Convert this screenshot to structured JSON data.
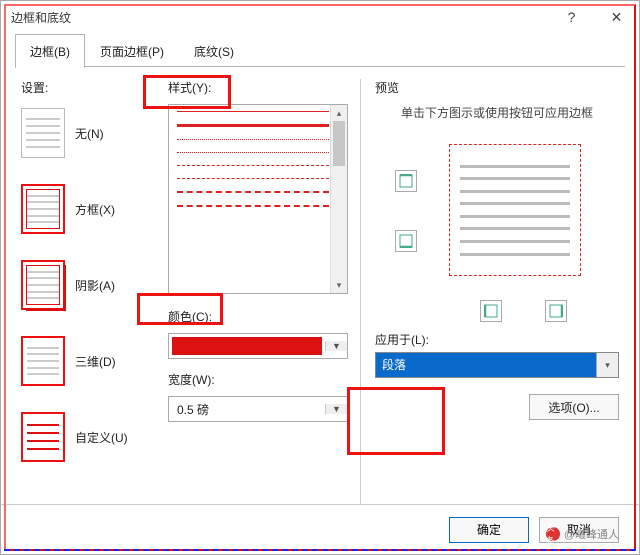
{
  "window": {
    "title": "边框和底纹",
    "help": "?",
    "close": "✕"
  },
  "tabs": {
    "borders": "边框(B)",
    "page_borders": "页面边框(P)",
    "shading": "底纹(S)"
  },
  "settings": {
    "label": "设置:",
    "none": "无(N)",
    "box": "方框(X)",
    "shadow": "阴影(A)",
    "threeD": "三维(D)",
    "custom": "自定义(U)"
  },
  "style": {
    "label": "样式(Y):"
  },
  "color": {
    "label": "颜色(C):",
    "value_hex": "#d11"
  },
  "width": {
    "label": "宽度(W):",
    "value": "0.5 磅"
  },
  "preview": {
    "label": "预览",
    "message": "单击下方图示或使用按钮可应用边框"
  },
  "apply_to": {
    "label": "应用于(L):",
    "value": "段落"
  },
  "options_btn": "选项(O)...",
  "footer": {
    "ok": "确定",
    "cancel": "取消"
  },
  "watermark": {
    "prefix": "头条",
    "text": "@曦峰通人"
  }
}
